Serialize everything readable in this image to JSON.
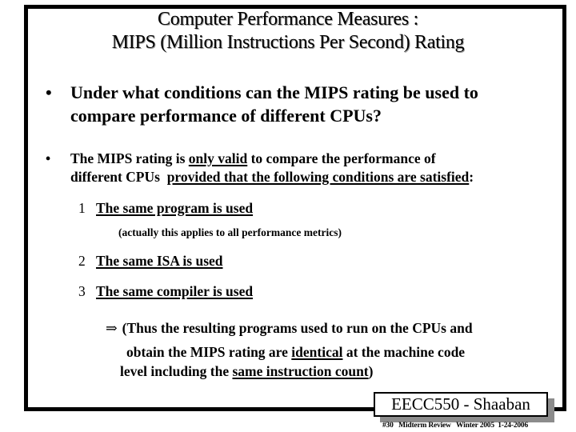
{
  "slide": {
    "title_line1": "Computer Performance Measures :",
    "title_line2": "MIPS (Million Instructions Per Second) Rating",
    "bullet_symbol": "•",
    "question": {
      "line1": "Under what conditions can the MIPS rating be used to",
      "line2": "compare performance of different CPUs?"
    },
    "answer": {
      "line1_pre": "The MIPS rating is ",
      "line1_underlined": "only valid",
      "line1_post": " to compare the performance of",
      "line2_pre": "different CPUs  ",
      "line2_underlined": "provided that the following conditions are satisfied",
      "line2_post": ":"
    },
    "conditions": [
      {
        "number": "1",
        "text": "The same program is used"
      },
      {
        "number": "2",
        "text": "The same ISA is used"
      },
      {
        "number": "3",
        "text": "The same compiler is used"
      }
    ],
    "condition_note": "(actually this applies to all performance metrics)",
    "implication": {
      "arrow": "⇒",
      "line1": "(Thus the resulting programs used to run on the CPUs and",
      "line2_pre": "obtain the MIPS rating are ",
      "line2_underlined": "identical",
      "line2_post": " at the machine code",
      "line3_pre": "level including the ",
      "line3_underlined": "same instruction count",
      "line3_post": ")"
    }
  },
  "footer": {
    "course": "EECC550 - Shaaban",
    "details": "#30   Midterm Review   Winter 2005  1-24-2006"
  },
  "colors": {
    "border": "#000000",
    "shadow": "#8c8c8c",
    "background": "#ffffff"
  }
}
